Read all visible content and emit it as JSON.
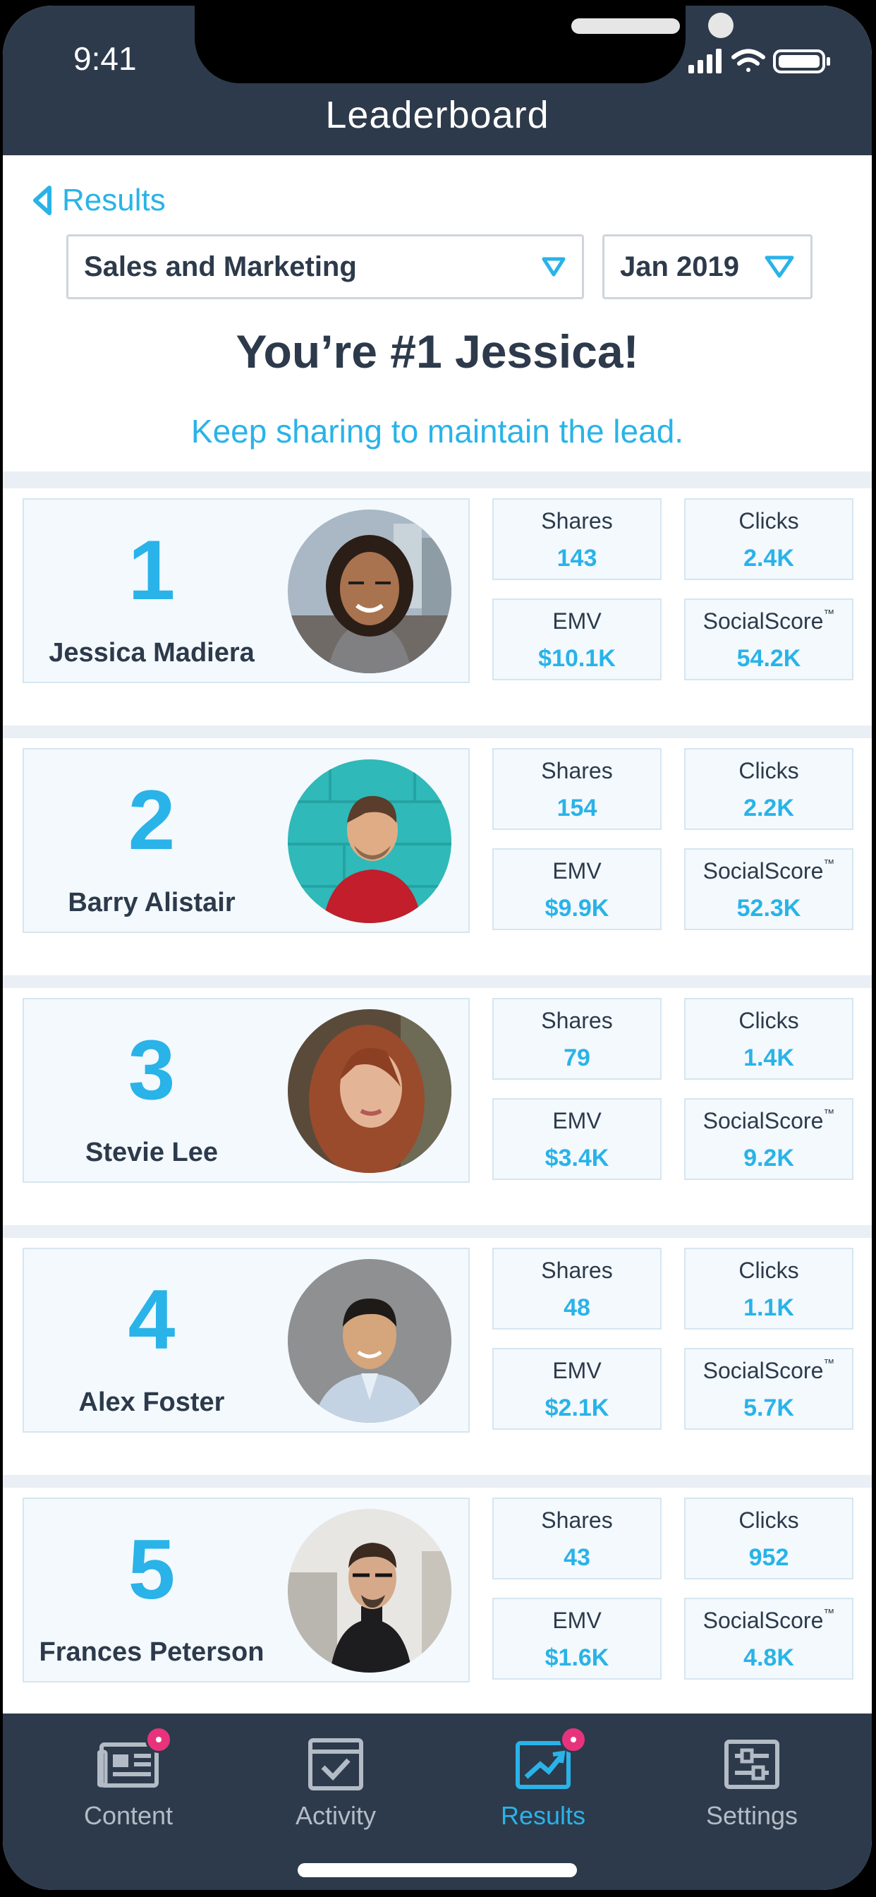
{
  "status_bar": {
    "time": "9:41"
  },
  "header": {
    "title": "Leaderboard"
  },
  "back": {
    "label": "Results"
  },
  "filters": {
    "department": "Sales and Marketing",
    "month": "Jan 2019"
  },
  "hero": {
    "headline": "You’re #1 Jessica!",
    "subtitle": "Keep sharing to maintain the lead."
  },
  "stat_labels": {
    "shares": "Shares",
    "clicks": "Clicks",
    "emv": "EMV",
    "social_score": "SocialScore",
    "trademark": "™"
  },
  "leaders": [
    {
      "rank": "1",
      "name": "Jessica Madiera",
      "shares": "143",
      "clicks": "2.4K",
      "emv": "$10.1K",
      "social_score": "54.2K"
    },
    {
      "rank": "2",
      "name": "Barry Alistair",
      "shares": "154",
      "clicks": "2.2K",
      "emv": "$9.9K",
      "social_score": "52.3K"
    },
    {
      "rank": "3",
      "name": "Stevie Lee",
      "shares": "79",
      "clicks": "1.4K",
      "emv": "$3.4K",
      "social_score": "9.2K"
    },
    {
      "rank": "4",
      "name": "Alex Foster",
      "shares": "48",
      "clicks": "1.1K",
      "emv": "$2.1K",
      "social_score": "5.7K"
    },
    {
      "rank": "5",
      "name": "Frances Peterson",
      "shares": "43",
      "clicks": "952",
      "emv": "$1.6K",
      "social_score": "4.8K"
    }
  ],
  "tabs": [
    {
      "label": "Content",
      "icon": "newspaper-icon",
      "badge": true,
      "active": false
    },
    {
      "label": "Activity",
      "icon": "checkbox-icon",
      "badge": false,
      "active": false
    },
    {
      "label": "Results",
      "icon": "chart-trend-icon",
      "badge": true,
      "active": true
    },
    {
      "label": "Settings",
      "icon": "sliders-icon",
      "badge": false,
      "active": false
    }
  ],
  "colors": {
    "header_bg": "#2d3a4b",
    "accent": "#29b3e8",
    "card_bg": "#f3f9fd",
    "badge": "#e8337c"
  }
}
